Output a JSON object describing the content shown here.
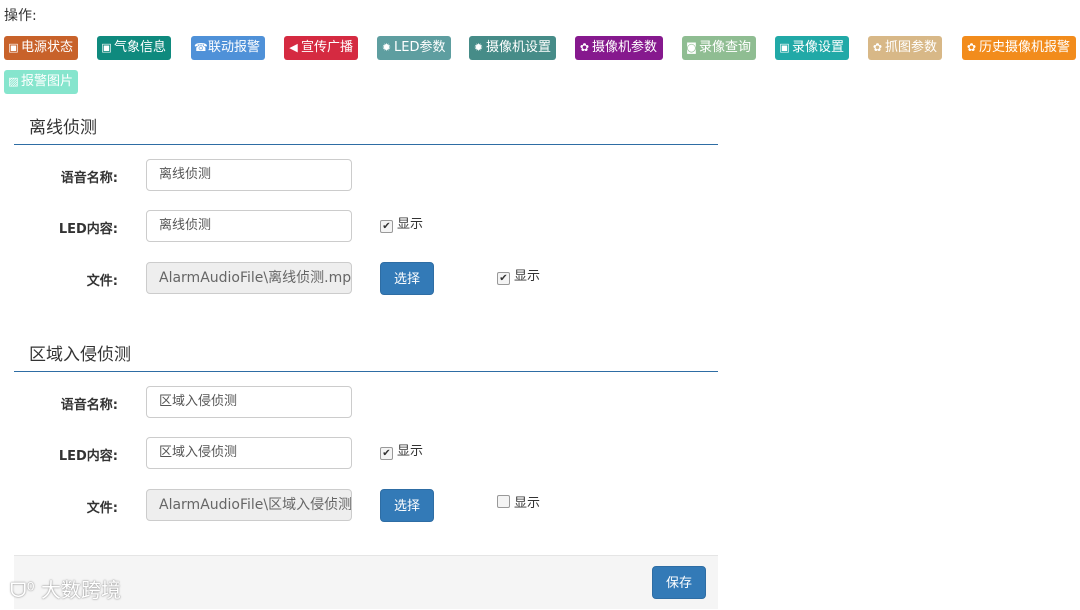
{
  "ops_label": "操作:",
  "toolbar": [
    {
      "label": "电源状态",
      "icon": "monitor-icon",
      "color": "#c8622a"
    },
    {
      "label": "气象信息",
      "icon": "monitor-icon",
      "color": "#0f8a7e"
    },
    {
      "label": "联动报警",
      "icon": "phone-icon",
      "color": "#4f91d8"
    },
    {
      "label": "宣传广播",
      "icon": "megaphone-icon",
      "color": "#d52a41"
    },
    {
      "label": "LED参数",
      "icon": "sun-icon",
      "color": "#5e9ea0"
    },
    {
      "label": "摄像机设置",
      "icon": "sun-icon",
      "color": "#468c88"
    },
    {
      "label": "摄像机参数",
      "icon": "gear-icon",
      "color": "#86198e"
    },
    {
      "label": "录像查询",
      "icon": "camera-icon",
      "color": "#8fbd92"
    },
    {
      "label": "录像设置",
      "icon": "monitor-icon",
      "color": "#21a9a7"
    },
    {
      "label": "抓图参数",
      "icon": "gear-icon",
      "color": "#d8b887"
    },
    {
      "label": "历史摄像机报警",
      "icon": "gear-icon",
      "color": "#f28c1c"
    },
    {
      "label": "报警图片",
      "icon": "image-icon",
      "color": "#86e5cd"
    }
  ],
  "sections": [
    {
      "title": "离线侦测",
      "voice_label": "语音名称:",
      "voice_value": "离线侦测",
      "led_label": "LED内容:",
      "led_value": "离线侦测",
      "led_show_label": "显示",
      "led_show_checked": true,
      "file_label": "文件:",
      "file_value": "AlarmAudioFile\\离线侦测.mp",
      "choose_label": "选择",
      "file_show_label": "显示",
      "file_show_checked": true
    },
    {
      "title": "区域入侵侦测",
      "voice_label": "语音名称:",
      "voice_value": "区域入侵侦测",
      "led_label": "LED内容:",
      "led_value": "区域入侵侦测",
      "led_show_label": "显示",
      "led_show_checked": true,
      "file_label": "文件:",
      "file_value": "AlarmAudioFile\\区域入侵侦测",
      "choose_label": "选择",
      "file_show_label": "显示",
      "file_show_checked": false
    }
  ],
  "footer": {
    "save_label": "保存"
  },
  "watermark": "大数跨境"
}
